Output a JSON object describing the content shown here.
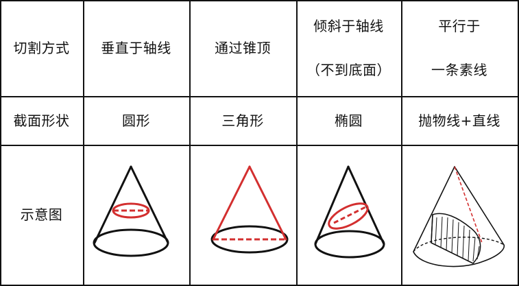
{
  "table": {
    "row_headers": {
      "method": "切割方式",
      "shape": "截面形状",
      "diagram": "示意图"
    },
    "columns": [
      {
        "method_line1": "垂直于轴线",
        "method_line2": "",
        "shape": "圆形",
        "diagram_icon": "cone-horizontal-ellipse-section"
      },
      {
        "method_line1": "通过锥顶",
        "method_line2": "",
        "shape": "三角形",
        "diagram_icon": "cone-triangle-section"
      },
      {
        "method_line1": "倾斜于轴线",
        "method_line2": "（不到底面）",
        "shape": "椭圆",
        "diagram_icon": "cone-oblique-ellipse-section"
      },
      {
        "method_line1": "平行于",
        "method_line2": "一条素线",
        "shape": "抛物线+直线",
        "diagram_icon": "cone-parabola-section"
      }
    ]
  },
  "colors": {
    "line": "#111111",
    "accent": "#d32f2f",
    "background": "#ffffff"
  }
}
